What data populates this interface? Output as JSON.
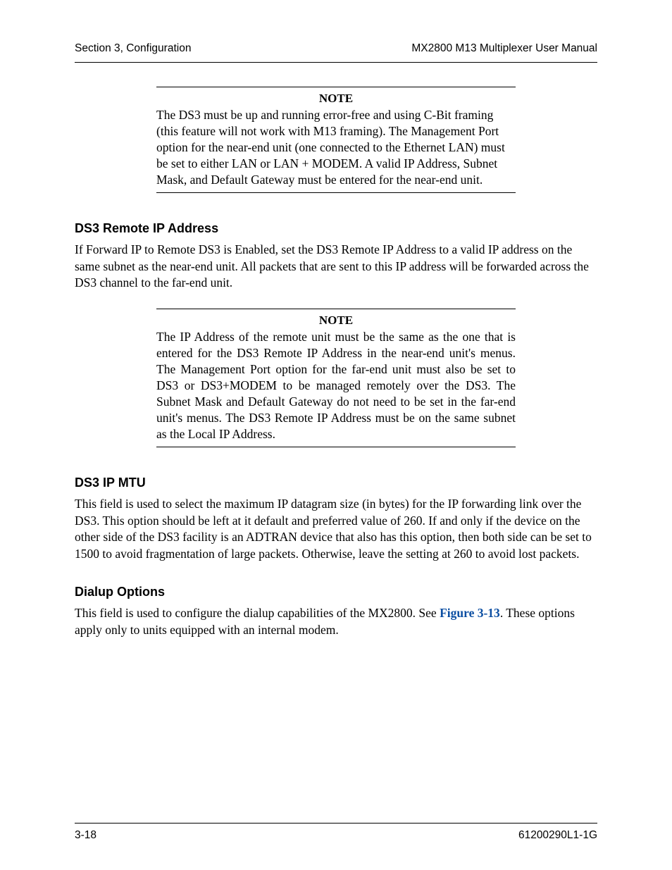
{
  "header": {
    "left": "Section 3, Configuration",
    "right": "MX2800 M13 Multiplexer User Manual"
  },
  "note1": {
    "title": "NOTE",
    "body": "The DS3 must be up and running error-free and using C-Bit framing (this feature will not work with M13 framing). The Management Port option for the near-end unit (one connected to the Ethernet LAN) must be set to either LAN or LAN + MODEM. A valid IP Address, Subnet Mask, and Default Gateway must be entered for the near-end unit."
  },
  "sec1": {
    "heading": "DS3 Remote IP Address",
    "body": "If Forward IP to Remote DS3 is Enabled, set the DS3 Remote IP Address to a valid IP address on the same subnet as the near-end unit. All packets that are sent to this IP address will be forwarded across the DS3 channel to the far-end unit."
  },
  "note2": {
    "title": "NOTE",
    "body": "The IP Address of the remote unit must be the same as the one that is entered for the DS3 Remote IP Address in the near-end unit's menus. The Management Port option for the far-end unit must also be set to DS3 or DS3+MODEM to be managed remotely over the DS3. The Subnet Mask and Default Gateway do not need to be set in the far-end unit's menus. The DS3 Remote IP Address must be on the same subnet as the Local IP Address."
  },
  "sec2": {
    "heading": "DS3 IP MTU",
    "body": "This field is used to select the maximum IP datagram size (in bytes) for the IP forwarding link over the DS3. This option should be left at it default and preferred value of 260. If and only if the device on the other side of the DS3 facility is an ADTRAN device that also has this option, then both side can be set to 1500 to avoid fragmentation of large packets. Otherwise, leave the setting at 260 to avoid lost packets."
  },
  "sec3": {
    "heading": "Dialup Options",
    "body_pre": "This field is used to configure the dialup capabilities of the MX2800. See ",
    "xref": "Figure 3-13",
    "body_post": ". These options apply only to units equipped with an internal modem."
  },
  "footer": {
    "left": "3-18",
    "right": "61200290L1-1G"
  }
}
